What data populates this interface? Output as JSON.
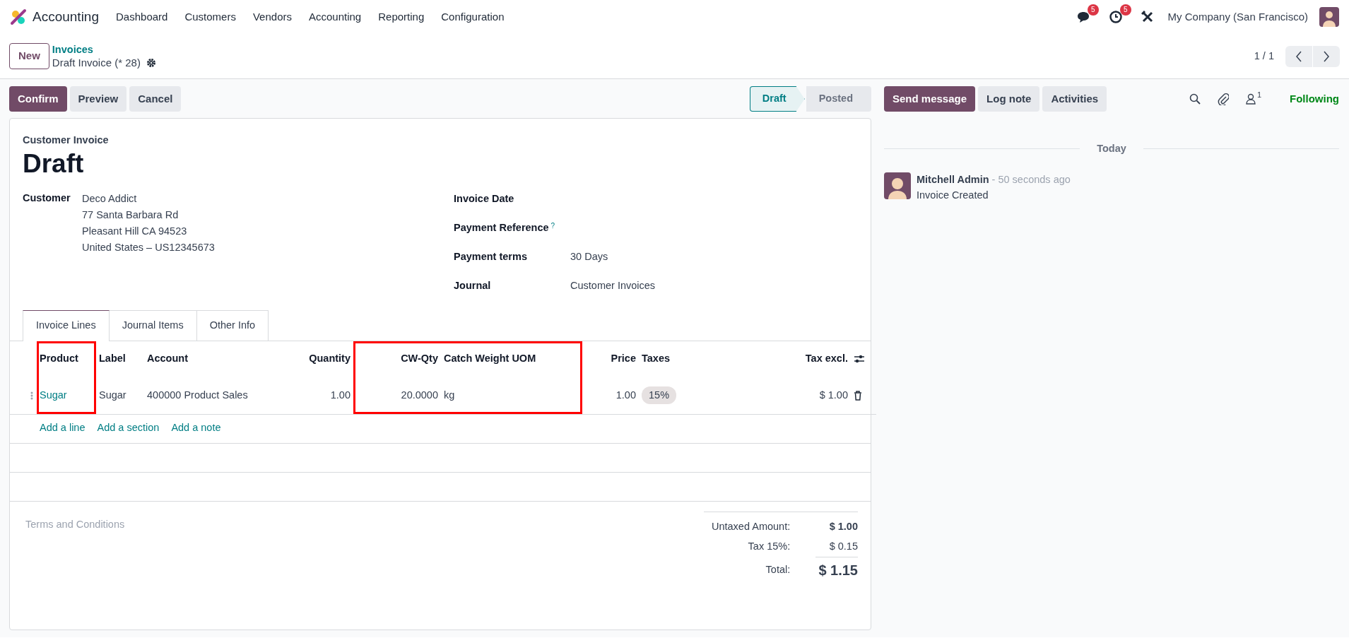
{
  "app": {
    "name": "Accounting"
  },
  "menu": [
    "Dashboard",
    "Customers",
    "Vendors",
    "Accounting",
    "Reporting",
    "Configuration"
  ],
  "systray": {
    "messages_count": "5",
    "activities_count": "5",
    "company": "My Company (San Francisco)"
  },
  "new_button": "New",
  "breadcrumb": {
    "parent": "Invoices",
    "current": "Draft Invoice (* 28)"
  },
  "pager": "1 / 1",
  "actions": [
    {
      "label": "Confirm",
      "primary": true
    },
    {
      "label": "Preview",
      "primary": false
    },
    {
      "label": "Cancel",
      "primary": false
    }
  ],
  "status": [
    {
      "label": "Draft",
      "selected": true
    },
    {
      "label": "Posted",
      "selected": false
    }
  ],
  "form": {
    "type_label": "Customer Invoice",
    "title": "Draft",
    "customer": {
      "label": "Customer",
      "lines": [
        "Deco Addict",
        "77 Santa Barbara Rd",
        "Pleasant Hill CA 94523",
        "United States – US12345673"
      ]
    },
    "fields": [
      {
        "label": "Invoice Date"
      },
      {
        "label": "Payment Reference",
        "help": "?"
      },
      {
        "label": "Payment terms",
        "value": "30 Days"
      },
      {
        "label": "Journal",
        "value": "Customer Invoices"
      }
    ]
  },
  "tabs": [
    {
      "label": "Invoice Lines",
      "selected": true
    },
    {
      "label": "Journal Items",
      "selected": false
    },
    {
      "label": "Other Info",
      "selected": false
    }
  ],
  "table": {
    "columns": [
      {
        "label": "Product",
        "kind": "link",
        "highlighted": true
      },
      {
        "label": "Label",
        "kind": "text",
        "highlighted": false
      },
      {
        "label": "Account",
        "kind": "text",
        "highlighted": false
      },
      {
        "label": "Quantity",
        "kind": "number",
        "highlighted": false
      },
      {
        "label": "CW-Qty",
        "kind": "number",
        "highlighted": true
      },
      {
        "label": "Catch Weight UOM",
        "kind": "text",
        "highlighted": true
      },
      {
        "label": "Price",
        "kind": "number",
        "highlighted": false
      },
      {
        "label": "Taxes",
        "kind": "tag",
        "highlighted": false
      },
      {
        "label": "Tax excl.",
        "kind": "number",
        "highlighted": false
      }
    ],
    "rows": [
      {
        "cells": [
          "Sugar",
          "Sugar",
          "400000 Product Sales",
          "1.00",
          "20.0000",
          "kg",
          "1.00",
          "15%",
          "$ 1.00"
        ]
      }
    ],
    "add_links": [
      "Add a line",
      "Add a section",
      "Add a note"
    ]
  },
  "terms_placeholder": "Terms and Conditions",
  "totals": [
    {
      "label": "Untaxed Amount:",
      "value": "$ 1.00",
      "kind": "subtotal"
    },
    {
      "label": "Tax 15%:",
      "value": "$ 0.15",
      "kind": "tax"
    },
    {
      "label": "Total:",
      "value": "$ 1.15",
      "kind": "total"
    }
  ],
  "chatter": {
    "buttons": [
      {
        "label": "Send message",
        "primary": true
      },
      {
        "label": "Log note",
        "primary": false
      },
      {
        "label": "Activities",
        "primary": false
      }
    ],
    "followers_count": "1",
    "follow_label": "Following",
    "date_separator": "Today",
    "messages": [
      {
        "author": "Mitchell Admin",
        "time": "- 50 seconds ago",
        "body": "Invoice Created"
      }
    ]
  }
}
